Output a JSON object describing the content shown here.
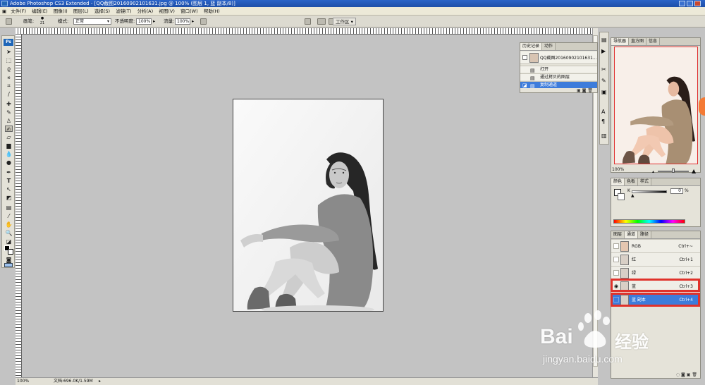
{
  "window": {
    "title": "Adobe Photoshop CS3 Extended - [QQ截图20160902101631.jpg @ 100% (图层 1, 蓝 副本/8)]"
  },
  "menu": [
    "文件(F)",
    "编辑(E)",
    "图像(I)",
    "图层(L)",
    "选择(S)",
    "滤镜(T)",
    "分析(A)",
    "视图(V)",
    "窗口(W)",
    "帮助(H)"
  ],
  "options": {
    "brush_label": "画笔:",
    "brush_size": "21",
    "mode_label": "模式:",
    "mode_value": "正常",
    "opacity_label": "不透明度:",
    "opacity_value": "100%",
    "flow_label": "流量:",
    "flow_value": "100%",
    "workspace_label": "工作区 ▾"
  },
  "toolbox": {
    "logo": "Ps"
  },
  "history": {
    "tabs": [
      "历史记录",
      "动作"
    ],
    "snapshot": "QQ截图20160902101631...",
    "items": [
      {
        "label": "打开",
        "selected": false
      },
      {
        "label": "通过拷贝的图层",
        "selected": false
      },
      {
        "label": "复制通道",
        "selected": true
      }
    ]
  },
  "navigator": {
    "tabs": [
      "导航器",
      "直方图",
      "信息"
    ],
    "zoom": "100%"
  },
  "color_panel": {
    "tabs": [
      "颜色",
      "色板",
      "样式"
    ],
    "channel_label": "K",
    "value": "0",
    "unit": "%"
  },
  "channels_panel": {
    "tabs": [
      "图层",
      "通道",
      "路径"
    ],
    "rows": [
      {
        "name": "RGB",
        "shortcut": "Ctrl+~",
        "visible": false,
        "selected": false
      },
      {
        "name": "红",
        "shortcut": "Ctrl+1",
        "visible": false,
        "selected": false
      },
      {
        "name": "绿",
        "shortcut": "Ctrl+2",
        "visible": false,
        "selected": false
      },
      {
        "name": "蓝",
        "shortcut": "Ctrl+3",
        "visible": true,
        "selected": false
      },
      {
        "name": "蓝 副本",
        "shortcut": "Ctrl+4",
        "visible": false,
        "selected": true
      }
    ]
  },
  "status": {
    "zoom": "100%",
    "doc_info": "文档:696.0K/1.59M"
  },
  "watermark": {
    "brand": "Bai",
    "brand2": "经验",
    "url": "jingyan.baidu.com"
  },
  "colors": {
    "accent": "#3d7cdb",
    "highlight": "#e0322b"
  }
}
